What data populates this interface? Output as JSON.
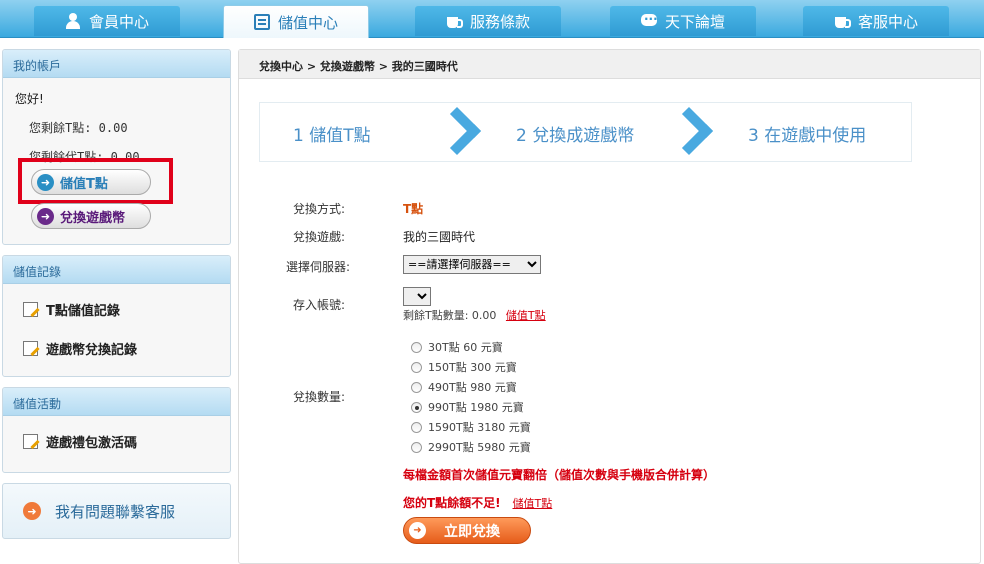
{
  "nav": {
    "tabs": [
      {
        "label": "會員中心",
        "icon": "user-icon"
      },
      {
        "label": "儲值中心",
        "icon": "card-icon"
      },
      {
        "label": "服務條款",
        "icon": "cup-icon"
      },
      {
        "label": "天下論壇",
        "icon": "chat-icon"
      },
      {
        "label": "客服中心",
        "icon": "cup-icon"
      }
    ]
  },
  "sidebar": {
    "account": {
      "title": "我的帳戶",
      "greeting": "您好!",
      "balance_t": "您剩餘T點: 0.00",
      "balance_dai_t": "您剩餘代T點: 0.00",
      "topup_button": "儲值T點",
      "exchange_button": "兌換遊戲幣"
    },
    "records": {
      "title": "儲值記錄",
      "items": [
        "T點儲值記錄",
        "遊戲幣兌換記錄"
      ]
    },
    "events": {
      "title": "儲值活動",
      "items": [
        "遊戲禮包激活碼"
      ]
    },
    "help": "我有問題聯繫客服"
  },
  "main": {
    "breadcrumb": "兌換中心 > 兌換遊戲幣 > 我的三國時代",
    "steps": [
      "1 儲值T點",
      "2 兌換成遊戲幣",
      "3 在遊戲中使用"
    ],
    "form": {
      "method_label": "兌換方式:",
      "method_value": "T點",
      "game_label": "兌換遊戲:",
      "game_value": "我的三國時代",
      "server_label": "選擇伺服器:",
      "server_select": "==請選擇伺服器==",
      "account_label": "存入帳號:",
      "remaining": "剩餘T點數量: 0.00",
      "topup_link": "儲值T點",
      "amount_label": "兌換數量:",
      "options": [
        {
          "label": "30T點 60 元寶",
          "checked": false
        },
        {
          "label": "150T點 300 元寶",
          "checked": false
        },
        {
          "label": "490T點 980 元寶",
          "checked": false
        },
        {
          "label": "990T點 1980 元寶",
          "checked": true
        },
        {
          "label": "1590T點 3180 元寶",
          "checked": false
        },
        {
          "label": "2990T點 5980 元寶",
          "checked": false
        }
      ],
      "promo": "每檔金額首次儲值元寶翻倍（儲值次數與手機版合併計算）",
      "insufficient": "您的T點餘額不足!",
      "insufficient_link": "儲值T點",
      "submit": "立即兌換"
    }
  }
}
